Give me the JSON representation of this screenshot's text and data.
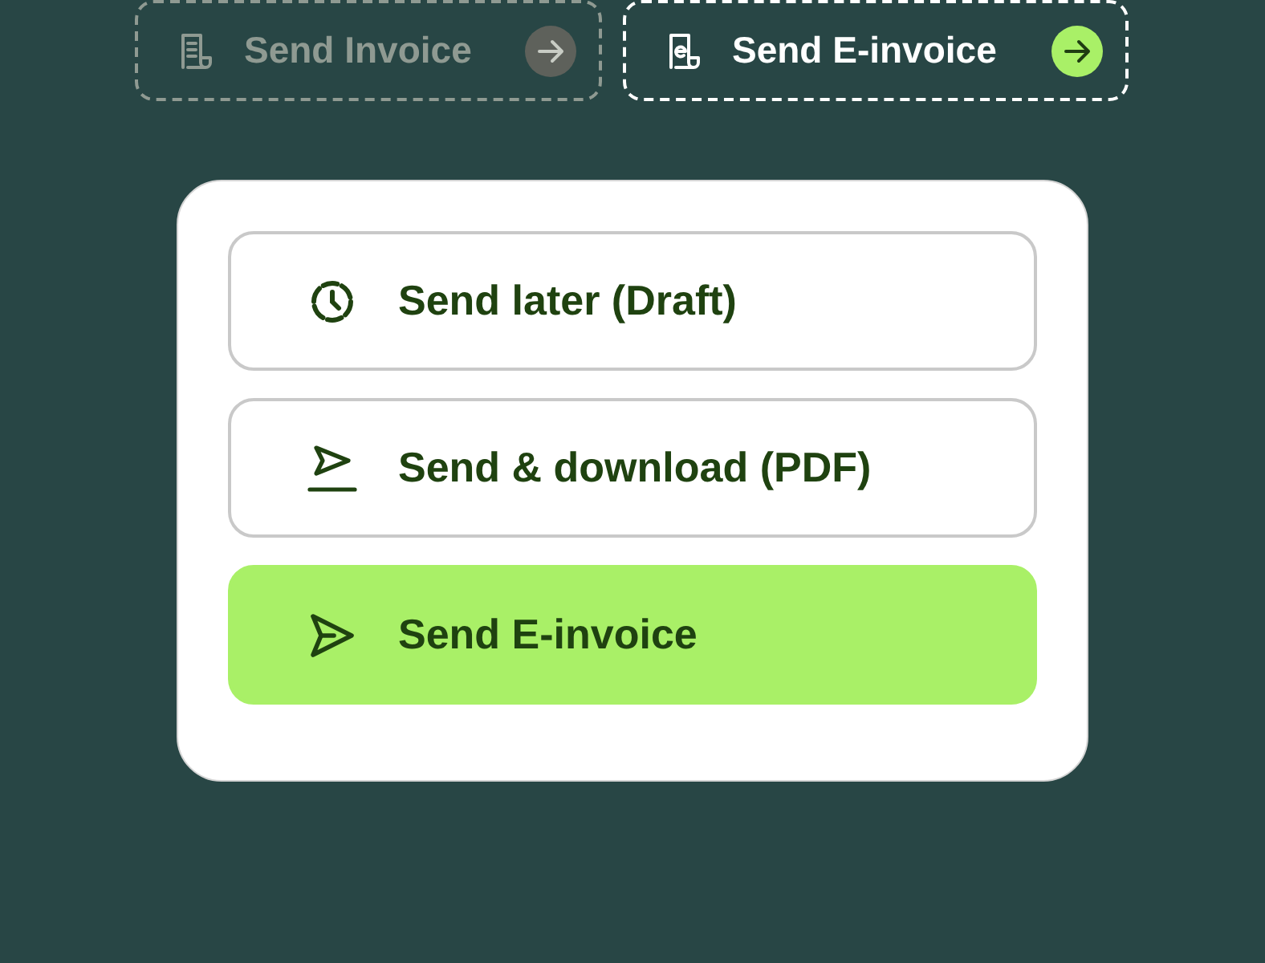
{
  "tabs": [
    {
      "label": "Send Invoice",
      "kind": "invoice",
      "selected": false
    },
    {
      "label": "Send E-invoice",
      "kind": "einvoice",
      "selected": true
    }
  ],
  "options": [
    {
      "label": "Send later (Draft)",
      "kind": "clock",
      "selected": false
    },
    {
      "label": "Send & download (PDF)",
      "kind": "download",
      "selected": false
    },
    {
      "label": "Send E-invoice",
      "kind": "send",
      "selected": true
    }
  ]
}
